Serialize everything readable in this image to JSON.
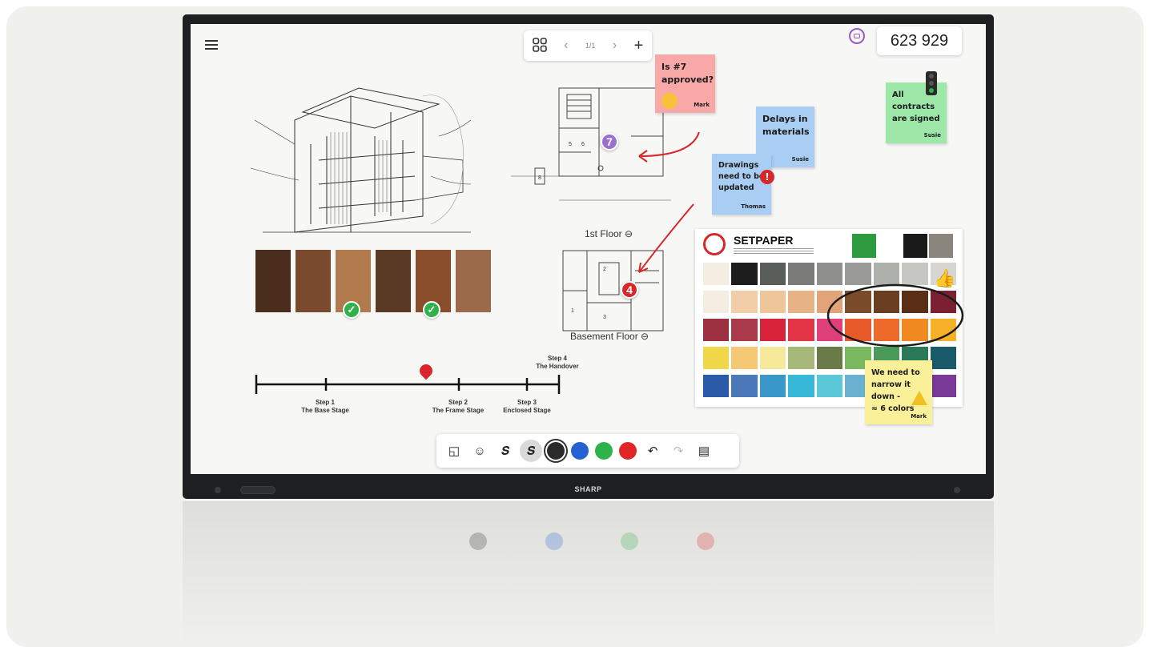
{
  "toolbar_top": {
    "page_indicator": "1/1",
    "prev_label": "‹",
    "next_label": "›",
    "add_label": "+",
    "grid_icon": "grid-icon"
  },
  "room_code": "623 929",
  "stickies": {
    "approved": {
      "text": "Is #7\napproved?",
      "author": "Mark",
      "color": "#f9a8a8"
    },
    "delays": {
      "text": "Delays in\nmaterials",
      "author": "Susie",
      "color": "#a9cdf3"
    },
    "drawings": {
      "text": "Drawings\nneed to be\nupdated",
      "author": "Thomas",
      "color": "#a9cdf3"
    },
    "contracts": {
      "text": "All\ncontracts\nare signed",
      "author": "Susie",
      "color": "#9de8a8"
    },
    "narrow": {
      "text": "We need to\nnarrow it\ndown -\n≈ 6 colors",
      "author": "Mark",
      "color": "#faf09a"
    }
  },
  "floors": {
    "first": "1st Floor",
    "basement": "Basement Floor"
  },
  "markers": {
    "a": "7",
    "b": "4"
  },
  "timeline": {
    "step1": "Step 1\nThe Base Stage",
    "step2": "Step 2\nThe Frame Stage",
    "step3": "Step 3\nEnclosed Stage",
    "step4": "Step 4\nThe Handover"
  },
  "wood_colors": [
    "#4a2d1c",
    "#7a4a2e",
    "#b07a4c",
    "#5a3a25",
    "#8a4e2c",
    "#9a6a4a"
  ],
  "setpaper": {
    "title": "SETPAPER",
    "swatches": [
      "#f3ede2",
      "#1d1d1d",
      "#5a5e5a",
      "#7a7a78",
      "#8f8f8d",
      "#9a9a98",
      "#aeb0ab",
      "#c6c6c2",
      "#d8d6d0",
      "#f3ede2",
      "#f1cda8",
      "#efc59a",
      "#e7b285",
      "#e0a478",
      "#7a4c2a",
      "#6a3e20",
      "#5a2e14",
      "#7a2030",
      "#9a3040",
      "#a83a4a",
      "#d8233a",
      "#e23545",
      "#e0407a",
      "#e85a2a",
      "#ee6a2a",
      "#f08a20",
      "#f5b028",
      "#f1d84a",
      "#f5c876",
      "#f6ea9a",
      "#a6b87a",
      "#6a7a48",
      "#7ab860",
      "#4a9a5a",
      "#2a7a5a",
      "#1a5a6a",
      "#2a5aa8",
      "#4a78b8",
      "#3a98c8",
      "#38b8d8",
      "#5ac8d8",
      "#6ab0d0",
      "#3a70c0",
      "#5a60a8",
      "#7a3a98"
    ],
    "top_swatches": [
      "#2e9a40",
      "#ffffff",
      "#1a1a1a",
      "#8a867e"
    ]
  },
  "brand": "SHARP",
  "tools": {
    "select": "◱",
    "sticker": "☺",
    "pen": "𝑺",
    "marker_pen": "𝑺",
    "undo": "↶",
    "redo": "↷",
    "clipboard": "▤"
  },
  "pen_colors": [
    "#2a2a2a",
    "#2461d1",
    "#2fb24a",
    "#e02626"
  ]
}
